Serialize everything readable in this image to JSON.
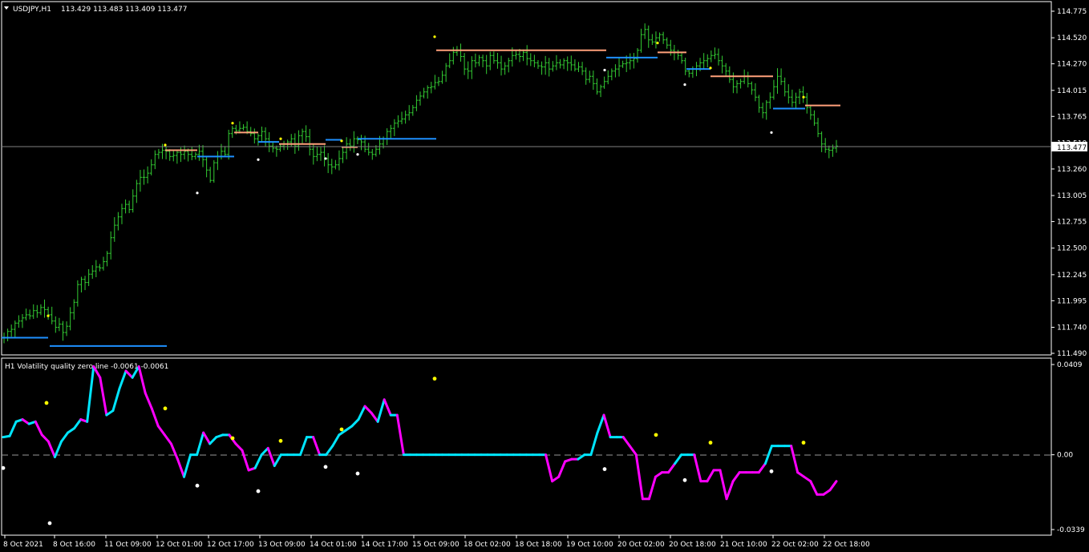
{
  "window": {
    "symbol_label": "USDJPY,H1",
    "ohlc": "113.429 113.483 113.409 113.477",
    "current_price": "113.477"
  },
  "indicator": {
    "label": "H1  Volatility quality zero line  -0.0061 -0.0061",
    "axis_labels": [
      "0.0409",
      "0.00",
      "-0.0339"
    ]
  },
  "colors": {
    "background": "#000000",
    "candles": "#33cc33",
    "resistance": "#ffa07a",
    "support": "#1e90ff",
    "dot_up": "#ffff00",
    "dot_down": "#ffffff",
    "vq_up": "#00e5ff",
    "vq_down": "#ff00ff",
    "axis": "#ffffff"
  },
  "chart_data": [
    {
      "type": "line",
      "title": "USDJPY,H1",
      "ylim": [
        111.49,
        114.8
      ],
      "y_ticks": [
        "114.775",
        "114.520",
        "114.270",
        "114.015",
        "113.765",
        "113.510",
        "113.260",
        "113.005",
        "112.755",
        "112.500",
        "112.245",
        "111.995",
        "111.740",
        "111.490"
      ],
      "x_ticks": [
        "8 Oct 2021",
        "8 Oct 16:00",
        "11 Oct 09:00",
        "12 Oct 01:00",
        "12 Oct 17:00",
        "13 Oct 09:00",
        "14 Oct 01:00",
        "14 Oct 17:00",
        "15 Oct 09:00",
        "18 Oct 02:00",
        "18 Oct 18:00",
        "19 Oct 10:00",
        "20 Oct 02:00",
        "20 Oct 18:00",
        "21 Oct 10:00",
        "22 Oct 02:00",
        "22 Oct 18:00"
      ],
      "series": [
        {
          "values": [
            111.64,
            111.7,
            111.72,
            111.78,
            111.8,
            111.83,
            111.86,
            111.85,
            111.9,
            111.88,
            111.93,
            111.91,
            111.86,
            111.8,
            111.74,
            111.77,
            111.69,
            111.75,
            111.88,
            111.98,
            112.15,
            112.2,
            112.17,
            112.25,
            112.28,
            112.32,
            112.31,
            112.37,
            112.45,
            112.6,
            112.72,
            112.8,
            112.88,
            112.92,
            112.87,
            113.0,
            113.12,
            113.18,
            113.18,
            113.22,
            113.3,
            113.4,
            113.42,
            113.44,
            113.43,
            113.38,
            113.39,
            113.42,
            113.4,
            113.43,
            113.4,
            113.38,
            113.4,
            113.43,
            113.35,
            113.25,
            113.15,
            113.32,
            113.38,
            113.43,
            113.4,
            113.6,
            113.65,
            113.63,
            113.65,
            113.66,
            113.62,
            113.6,
            113.55,
            113.58,
            113.62,
            113.55,
            113.48,
            113.46,
            113.45,
            113.48,
            113.5,
            113.52,
            113.55,
            113.48,
            113.58,
            113.62,
            113.57,
            113.45,
            113.38,
            113.4,
            113.42,
            113.36,
            113.3,
            113.28,
            113.3,
            113.36,
            113.42,
            113.5,
            113.48,
            113.55,
            113.54,
            113.52,
            113.45,
            113.42,
            113.4,
            113.45,
            113.5,
            113.55,
            113.62,
            113.65,
            113.7,
            113.72,
            113.74,
            113.78,
            113.8,
            113.85,
            113.92,
            113.96,
            114.0,
            114.04,
            114.05,
            114.09,
            114.1,
            114.16,
            114.25,
            114.3,
            114.38,
            114.4,
            114.34,
            114.22,
            114.2,
            114.3,
            114.28,
            114.33,
            114.3,
            114.25,
            114.35,
            114.3,
            114.28,
            114.22,
            114.25,
            114.3,
            114.35,
            114.36,
            114.34,
            114.38,
            114.32,
            114.3,
            114.28,
            114.25,
            114.24,
            114.28,
            114.22,
            114.25,
            114.28,
            114.26,
            114.3,
            114.28,
            114.26,
            114.22,
            114.24,
            114.2,
            114.12,
            114.15,
            114.08,
            114.0,
            114.05,
            114.1,
            114.15,
            114.2,
            114.22,
            114.25,
            114.27,
            114.28,
            114.3,
            114.32,
            114.4,
            114.55,
            114.6,
            114.5,
            114.48,
            114.52,
            114.55,
            114.5,
            114.45,
            114.4,
            114.38,
            114.35,
            114.3,
            114.2,
            114.18,
            114.22,
            114.25,
            114.28,
            114.3,
            114.32,
            114.35,
            114.36,
            114.3,
            114.25,
            114.2,
            114.12,
            114.05,
            114.08,
            114.1,
            114.15,
            114.08,
            114.02,
            113.95,
            113.85,
            113.8,
            113.9,
            113.95,
            114.05,
            114.15,
            114.1,
            114.0,
            113.95,
            113.9,
            113.95,
            114.0,
            113.95,
            113.85,
            113.78,
            113.7,
            113.6,
            113.5,
            113.45,
            113.44,
            113.46,
            113.48
          ]
        }
      ]
    },
    {
      "type": "line",
      "title": "Volatility quality zero line",
      "ylim": [
        -0.0339,
        0.0409
      ],
      "series": [
        {
          "name": "Volatility quality zero line",
          "values": [
            0.008,
            0.0085,
            0.015,
            0.016,
            0.014,
            0.015,
            0.009,
            0.006,
            -0.001,
            0.006,
            0.01,
            0.012,
            0.016,
            0.015,
            0.04,
            0.035,
            0.018,
            0.02,
            0.03,
            0.038,
            0.035,
            0.04,
            0.028,
            0.021,
            0.013,
            0.009,
            0.005,
            -0.002,
            -0.01,
            0.0,
            0.0,
            0.01,
            0.005,
            0.008,
            0.009,
            0.009,
            0.005,
            0.002,
            -0.007,
            -0.006,
            0.0,
            0.003,
            -0.005,
            0.0,
            0.0,
            0.0,
            0.0,
            0.008,
            0.008,
            0.0,
            0.0,
            0.004,
            0.009,
            0.011,
            0.013,
            0.016,
            0.022,
            0.019,
            0.015,
            0.025,
            0.018,
            0.018,
            0.0,
            0.0,
            0.0,
            0.0,
            0.0,
            0.0,
            0.0,
            0.0,
            0.0,
            0.0,
            0.0,
            0.0,
            0.0,
            0.0,
            0.0,
            0.0,
            0.0,
            0.0,
            0.0,
            0.0,
            0.0,
            0.0,
            0.0,
            -0.012,
            -0.01,
            -0.003,
            -0.002,
            -0.002,
            0.0,
            0.0,
            0.01,
            0.018,
            0.008,
            0.008,
            0.008,
            0.004,
            0.0,
            -0.02,
            -0.02,
            -0.01,
            -0.008,
            -0.008,
            -0.004,
            0.0,
            0.0,
            0.0,
            -0.012,
            -0.012,
            -0.007,
            -0.007,
            -0.02,
            -0.012,
            -0.008,
            -0.008,
            -0.008,
            -0.008,
            -0.004,
            0.004,
            0.004,
            0.004,
            0.004,
            -0.008,
            -0.01,
            -0.012,
            -0.018,
            -0.018,
            -0.016,
            -0.012
          ]
        }
      ]
    }
  ]
}
